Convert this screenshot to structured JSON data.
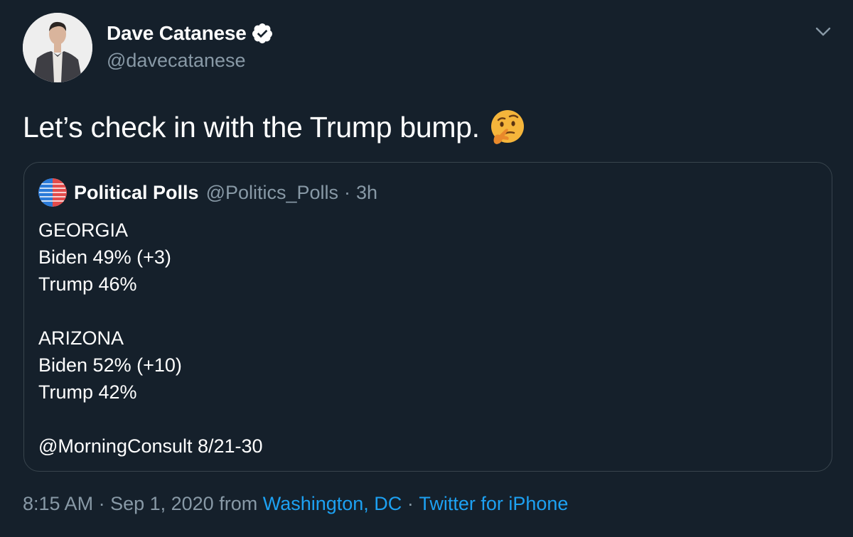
{
  "author": {
    "display_name": "Dave Catanese",
    "handle": "@davecatanese",
    "verified": true
  },
  "tweet": {
    "text": "Let’s check in with the Trump bump.",
    "emoji": "thinking-face"
  },
  "quoted_tweet": {
    "display_name": "Political Polls",
    "handle": "@Politics_Polls",
    "separator": "·",
    "time": "3h",
    "lines": [
      "GEORGIA",
      "Biden 49% (+3)",
      "Trump 46%",
      "",
      "ARIZONA",
      "Biden 52% (+10)",
      "Trump 42%",
      "",
      "@MorningConsult 8/21-30"
    ]
  },
  "footer": {
    "time": "8:15 AM",
    "sep1": " · ",
    "date": "Sep 1, 2020",
    "from": " from ",
    "location": "Washington, DC",
    "sep2": " · ",
    "source": "Twitter for iPhone"
  },
  "colors": {
    "background": "#15202b",
    "text_primary": "#ffffff",
    "text_secondary": "#8899a6",
    "link": "#1da1f2",
    "border": "#38444d"
  }
}
